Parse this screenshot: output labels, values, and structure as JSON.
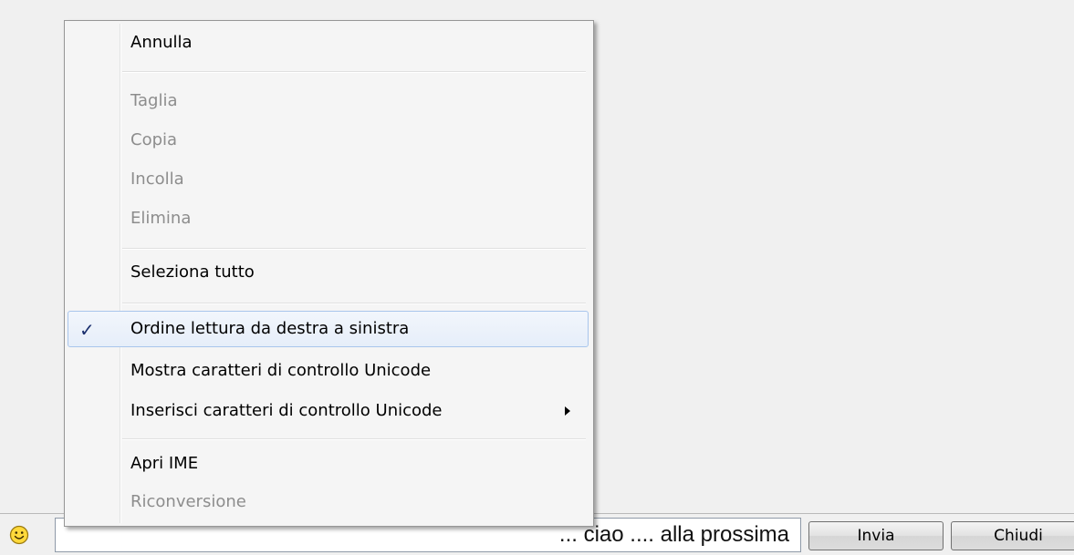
{
  "context_menu": {
    "items": [
      {
        "label": "Annulla",
        "enabled": true
      },
      {
        "label": "Taglia",
        "enabled": false
      },
      {
        "label": "Copia",
        "enabled": false
      },
      {
        "label": "Incolla",
        "enabled": false
      },
      {
        "label": "Elimina",
        "enabled": false
      },
      {
        "label": "Seleziona tutto",
        "enabled": true
      },
      {
        "label": "Ordine lettura da destra a sinistra",
        "enabled": true,
        "checked": true,
        "check_glyph": "✓"
      },
      {
        "label": "Mostra caratteri di controllo Unicode",
        "enabled": true
      },
      {
        "label": "Inserisci caratteri di controllo Unicode",
        "enabled": true,
        "has_submenu": true
      },
      {
        "label": "Apri IME",
        "enabled": true
      },
      {
        "label": "Riconversione",
        "enabled": false
      }
    ]
  },
  "chat_bar": {
    "emoticon_icon": "smiley-icon",
    "message_text": "... ciao .... alla prossima",
    "send_label": "Invia",
    "close_label": "Chiudi"
  },
  "colors": {
    "disabled_text": "#8d8d8d",
    "highlight_border": "#a8c5ec",
    "checkmark": "#1a2f6d"
  }
}
